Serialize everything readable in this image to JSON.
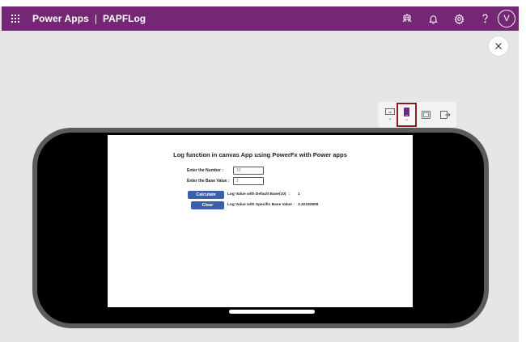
{
  "header": {
    "app_name": "Power Apps",
    "separator": "|",
    "app_title": "PAPFLog",
    "avatar_initial": "V"
  },
  "canvas": {
    "title": "Log function in canvas App using PowerFx with Power apps",
    "number_label": "Enter the Number :",
    "number_value": "10",
    "base_label": "Enter the Base Value :",
    "base_value": "2",
    "calculate_label": "Calculate",
    "clear_label": "Clear",
    "default_result_label": "Log Value with Default Base(10)",
    "default_result_sep": ":",
    "default_result_value": "1",
    "specific_result_label": "Log Value with Specific Base Value :",
    "specific_result_value": "3.32192809"
  },
  "device_toolbar": {
    "selected": "phone",
    "items": [
      "desktop",
      "phone",
      "tablet",
      "pop-out"
    ]
  },
  "colors": {
    "header_bg": "#742774",
    "button_bg": "#3d5fa8",
    "selected_border": "#8b1b22",
    "phone_frame": "#5b5b5b"
  }
}
